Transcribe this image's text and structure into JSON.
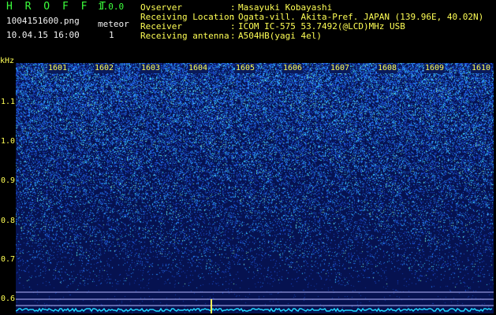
{
  "app": {
    "title": "H R O F F T",
    "version": "1.0.0"
  },
  "file": {
    "name": "1004151600.png",
    "timestamp": "10.04.15 16:00"
  },
  "meteor": {
    "label": "meteor",
    "count": "1"
  },
  "info": [
    {
      "label": "Ovserver",
      "value": "Masayuki Kobayashi"
    },
    {
      "label": "Receiving Location",
      "value": "Ogata-vill. Akita-Pref. JAPAN (139.96E, 40.02N)"
    },
    {
      "label": "Receiver",
      "value": "ICOM IC-575 53.7492(@LCD)MHz USB"
    },
    {
      "label": "Receiving antenna",
      "value": "A504HB(yagi 4el)"
    }
  ],
  "info_separator": ":",
  "y_axis": {
    "unit": "kHz",
    "ticks": [
      "1.1",
      "1.0",
      "0.9",
      "0.8",
      "0.7",
      "0.6"
    ]
  },
  "x_axis": {
    "ticks": [
      "1601",
      "1602",
      "1603",
      "1604",
      "1605",
      "1606",
      "1607",
      "1608",
      "1609",
      "1610"
    ]
  },
  "colors": {
    "title": "#3cff3c",
    "info": "#ffff55",
    "background": "#000000",
    "spectrogram_low": "#0a1a5a",
    "spectrogram_high": "#2ad0ff",
    "trace": "#1fd7ff"
  }
}
